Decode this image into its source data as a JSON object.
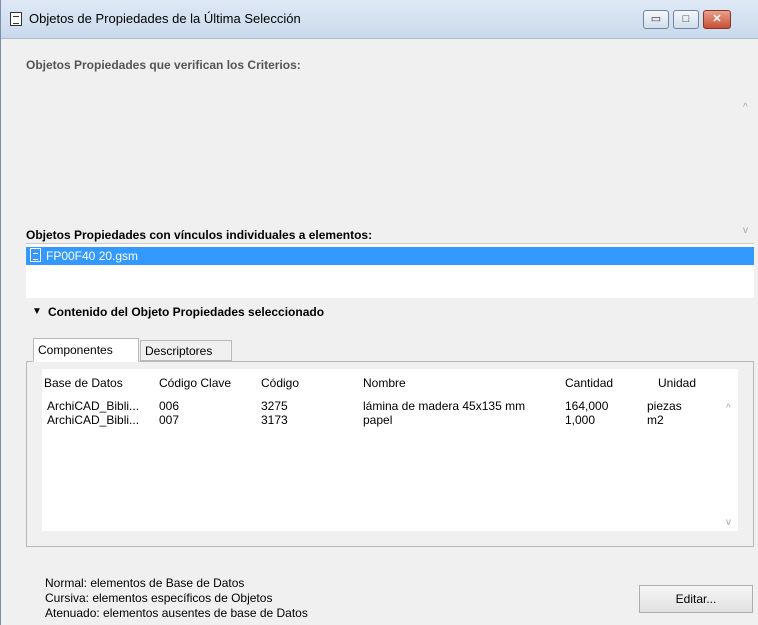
{
  "window": {
    "title": "Objetos de Propiedades de la Última Selección",
    "buttons": {
      "minimize": "▭",
      "maximize": "□",
      "close": "✕"
    }
  },
  "criteria": {
    "heading": "Objetos Propiedades que verifican los Criterios:"
  },
  "linked": {
    "heading": "Objetos Propiedades con vínculos individuales a elementos:",
    "selected_item": "FP00F40 20.gsm"
  },
  "contents": {
    "heading": "Contenido del Objeto Propiedades seleccionado",
    "tabs": [
      "Componentes",
      "Descriptores"
    ],
    "columns": [
      "Base de Datos",
      "Código Clave",
      "Código",
      "Nombre",
      "Cantidad",
      "Unidad"
    ],
    "rows": [
      [
        "ArchiCAD_Bibli...",
        "006",
        "3275",
        "lámina de madera 45x135 mm",
        "164,000",
        "piezas"
      ],
      [
        "ArchiCAD_Bibli...",
        "007",
        "3173",
        "papel",
        "1,000",
        "m2"
      ]
    ]
  },
  "legend": {
    "normal": "Normal: elementos de Base de Datos",
    "italic": "Cursiva: elementos específicos de Objetos",
    "faded": "Atenuado: elementos ausentes de base de Datos"
  },
  "edit_button": "Editar...",
  "icons": {
    "scroll_up": "^",
    "scroll_down": "v",
    "triangle": "▼"
  }
}
